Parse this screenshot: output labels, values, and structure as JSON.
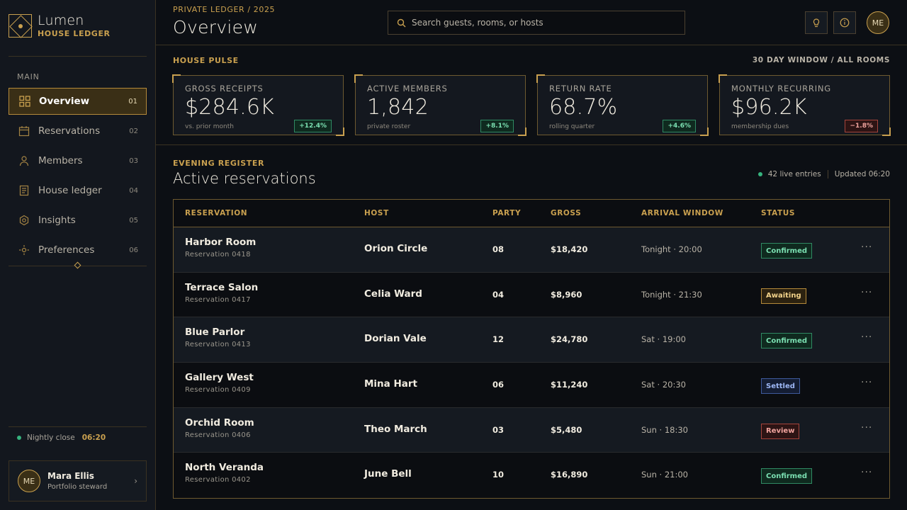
{
  "brand": {
    "name": "Lumen",
    "subtitle": "HOUSE LEDGER"
  },
  "sidebar": {
    "section": "MAIN",
    "items": [
      {
        "label": "Overview",
        "num": "01",
        "icon": "grid-icon",
        "active": true
      },
      {
        "label": "Reservations",
        "num": "02",
        "icon": "calendar-icon"
      },
      {
        "label": "Members",
        "num": "03",
        "icon": "person-icon"
      },
      {
        "label": "House ledger",
        "num": "04",
        "icon": "ledger-icon"
      },
      {
        "label": "Insights",
        "num": "05",
        "icon": "target-icon"
      },
      {
        "label": "Preferences",
        "num": "06",
        "icon": "sun-icon"
      }
    ],
    "nightly_label": "Nightly close",
    "nightly_time": "06:20",
    "user": {
      "initials": "ME",
      "name": "Mara Ellis",
      "role": "Portfolio steward"
    }
  },
  "header": {
    "breadcrumb": "PRIVATE LEDGER / 2025",
    "title": "Overview",
    "search_placeholder": "Search guests, rooms, or hosts",
    "avatar": "ME"
  },
  "pulse": {
    "label": "HOUSE PULSE",
    "window": "30 DAY WINDOW / ALL ROOMS",
    "kpis": [
      {
        "title": "GROSS RECEIPTS",
        "value": "$284.6K",
        "sub": "vs. prior month",
        "delta": "+12.4%",
        "trend": "up"
      },
      {
        "title": "ACTIVE MEMBERS",
        "value": "1,842",
        "sub": "private roster",
        "delta": "+8.1%",
        "trend": "up"
      },
      {
        "title": "RETURN RATE",
        "value": "68.7%",
        "sub": "rolling quarter",
        "delta": "+4.6%",
        "trend": "up"
      },
      {
        "title": "MONTHLY RECURRING",
        "value": "$96.2K",
        "sub": "membership dues",
        "delta": "−1.8%",
        "trend": "down"
      }
    ]
  },
  "register": {
    "label": "EVENING REGISTER",
    "title": "Active reservations",
    "live": "42 live entries",
    "updated": "Updated 06:20",
    "columns": [
      "RESERVATION",
      "HOST",
      "PARTY",
      "GROSS",
      "ARRIVAL WINDOW",
      "STATUS"
    ],
    "rows": [
      {
        "room": "Harbor Room",
        "code": "Reservation 0418",
        "host": "Orion Circle",
        "party": "08",
        "gross": "$18,420",
        "arrival": "Tonight · 20:00",
        "status": "Confirmed",
        "kind": "confirmed"
      },
      {
        "room": "Terrace Salon",
        "code": "Reservation 0417",
        "host": "Celia Ward",
        "party": "04",
        "gross": "$8,960",
        "arrival": "Tonight · 21:30",
        "status": "Awaiting",
        "kind": "awaiting"
      },
      {
        "room": "Blue Parlor",
        "code": "Reservation 0413",
        "host": "Dorian Vale",
        "party": "12",
        "gross": "$24,780",
        "arrival": "Sat · 19:00",
        "status": "Confirmed",
        "kind": "confirmed"
      },
      {
        "room": "Gallery West",
        "code": "Reservation 0409",
        "host": "Mina Hart",
        "party": "06",
        "gross": "$11,240",
        "arrival": "Sat · 20:30",
        "status": "Settled",
        "kind": "settled"
      },
      {
        "room": "Orchid Room",
        "code": "Reservation 0406",
        "host": "Theo March",
        "party": "03",
        "gross": "$5,480",
        "arrival": "Sun · 18:30",
        "status": "Review",
        "kind": "review"
      },
      {
        "room": "North Veranda",
        "code": "Reservation 0402",
        "host": "June Bell",
        "party": "10",
        "gross": "$16,890",
        "arrival": "Sun · 21:00",
        "status": "Confirmed",
        "kind": "confirmed"
      }
    ]
  },
  "colors": {
    "accent": "#c9a04f",
    "background": "#0c0f14",
    "sidebar": "#13171e",
    "positive": "#36b37e",
    "negative": "#a5443c"
  }
}
